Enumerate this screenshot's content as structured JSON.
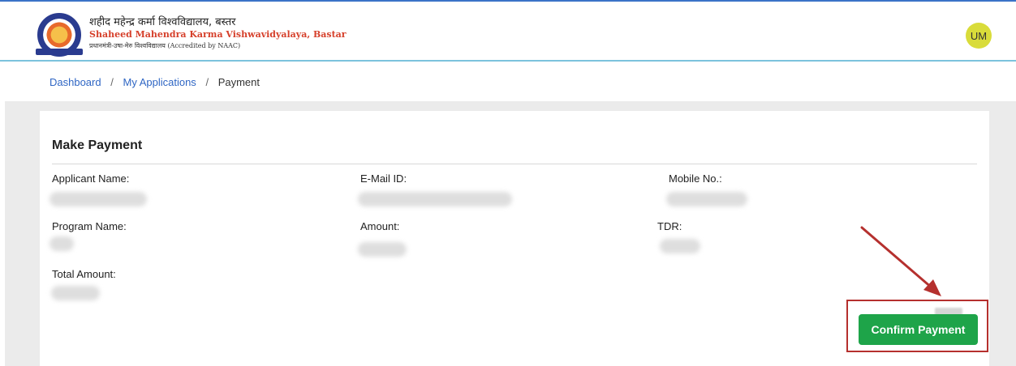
{
  "header": {
    "university_hindi": "शहीद महेन्द्र कर्मा विश्वविद्यालय, बस्तर",
    "university_english": "Shaheed Mahendra Karma Vishwavidyalaya, Bastar",
    "university_sub_hindi": "प्रधानमंत्री-उषा-मेरु विश्वविद्यालय",
    "accreditation": "(Accredited by NAAC)",
    "avatar_initials": "UM"
  },
  "breadcrumb": {
    "items": [
      "Dashboard",
      "My Applications"
    ],
    "current": "Payment",
    "separator": "/"
  },
  "payment_card": {
    "title": "Make Payment",
    "fields": {
      "applicant_name_label": "Applicant Name:",
      "email_label": "E-Mail ID:",
      "mobile_label": "Mobile No.:",
      "program_name_label": "Program Name:",
      "amount_label": "Amount:",
      "tdr_label": "TDR:",
      "total_amount_label": "Total Amount:"
    },
    "confirm_button": "Confirm Payment"
  },
  "colors": {
    "confirm_button": "#1ea449",
    "link": "#2f66c4",
    "annotation": "#b5302e",
    "avatar": "#d9dc3a"
  }
}
